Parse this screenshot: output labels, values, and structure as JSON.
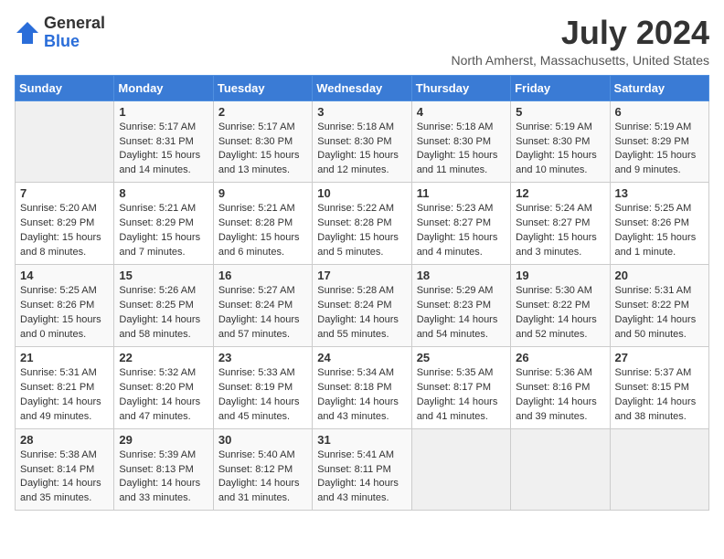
{
  "logo": {
    "general": "General",
    "blue": "Blue"
  },
  "header": {
    "title": "July 2024",
    "location": "North Amherst, Massachusetts, United States"
  },
  "weekdays": [
    "Sunday",
    "Monday",
    "Tuesday",
    "Wednesday",
    "Thursday",
    "Friday",
    "Saturday"
  ],
  "weeks": [
    [
      {
        "day": "",
        "info": ""
      },
      {
        "day": "1",
        "info": "Sunrise: 5:17 AM\nSunset: 8:31 PM\nDaylight: 15 hours\nand 14 minutes."
      },
      {
        "day": "2",
        "info": "Sunrise: 5:17 AM\nSunset: 8:30 PM\nDaylight: 15 hours\nand 13 minutes."
      },
      {
        "day": "3",
        "info": "Sunrise: 5:18 AM\nSunset: 8:30 PM\nDaylight: 15 hours\nand 12 minutes."
      },
      {
        "day": "4",
        "info": "Sunrise: 5:18 AM\nSunset: 8:30 PM\nDaylight: 15 hours\nand 11 minutes."
      },
      {
        "day": "5",
        "info": "Sunrise: 5:19 AM\nSunset: 8:30 PM\nDaylight: 15 hours\nand 10 minutes."
      },
      {
        "day": "6",
        "info": "Sunrise: 5:19 AM\nSunset: 8:29 PM\nDaylight: 15 hours\nand 9 minutes."
      }
    ],
    [
      {
        "day": "7",
        "info": "Sunrise: 5:20 AM\nSunset: 8:29 PM\nDaylight: 15 hours\nand 8 minutes."
      },
      {
        "day": "8",
        "info": "Sunrise: 5:21 AM\nSunset: 8:29 PM\nDaylight: 15 hours\nand 7 minutes."
      },
      {
        "day": "9",
        "info": "Sunrise: 5:21 AM\nSunset: 8:28 PM\nDaylight: 15 hours\nand 6 minutes."
      },
      {
        "day": "10",
        "info": "Sunrise: 5:22 AM\nSunset: 8:28 PM\nDaylight: 15 hours\nand 5 minutes."
      },
      {
        "day": "11",
        "info": "Sunrise: 5:23 AM\nSunset: 8:27 PM\nDaylight: 15 hours\nand 4 minutes."
      },
      {
        "day": "12",
        "info": "Sunrise: 5:24 AM\nSunset: 8:27 PM\nDaylight: 15 hours\nand 3 minutes."
      },
      {
        "day": "13",
        "info": "Sunrise: 5:25 AM\nSunset: 8:26 PM\nDaylight: 15 hours\nand 1 minute."
      }
    ],
    [
      {
        "day": "14",
        "info": "Sunrise: 5:25 AM\nSunset: 8:26 PM\nDaylight: 15 hours\nand 0 minutes."
      },
      {
        "day": "15",
        "info": "Sunrise: 5:26 AM\nSunset: 8:25 PM\nDaylight: 14 hours\nand 58 minutes."
      },
      {
        "day": "16",
        "info": "Sunrise: 5:27 AM\nSunset: 8:24 PM\nDaylight: 14 hours\nand 57 minutes."
      },
      {
        "day": "17",
        "info": "Sunrise: 5:28 AM\nSunset: 8:24 PM\nDaylight: 14 hours\nand 55 minutes."
      },
      {
        "day": "18",
        "info": "Sunrise: 5:29 AM\nSunset: 8:23 PM\nDaylight: 14 hours\nand 54 minutes."
      },
      {
        "day": "19",
        "info": "Sunrise: 5:30 AM\nSunset: 8:22 PM\nDaylight: 14 hours\nand 52 minutes."
      },
      {
        "day": "20",
        "info": "Sunrise: 5:31 AM\nSunset: 8:22 PM\nDaylight: 14 hours\nand 50 minutes."
      }
    ],
    [
      {
        "day": "21",
        "info": "Sunrise: 5:31 AM\nSunset: 8:21 PM\nDaylight: 14 hours\nand 49 minutes."
      },
      {
        "day": "22",
        "info": "Sunrise: 5:32 AM\nSunset: 8:20 PM\nDaylight: 14 hours\nand 47 minutes."
      },
      {
        "day": "23",
        "info": "Sunrise: 5:33 AM\nSunset: 8:19 PM\nDaylight: 14 hours\nand 45 minutes."
      },
      {
        "day": "24",
        "info": "Sunrise: 5:34 AM\nSunset: 8:18 PM\nDaylight: 14 hours\nand 43 minutes."
      },
      {
        "day": "25",
        "info": "Sunrise: 5:35 AM\nSunset: 8:17 PM\nDaylight: 14 hours\nand 41 minutes."
      },
      {
        "day": "26",
        "info": "Sunrise: 5:36 AM\nSunset: 8:16 PM\nDaylight: 14 hours\nand 39 minutes."
      },
      {
        "day": "27",
        "info": "Sunrise: 5:37 AM\nSunset: 8:15 PM\nDaylight: 14 hours\nand 38 minutes."
      }
    ],
    [
      {
        "day": "28",
        "info": "Sunrise: 5:38 AM\nSunset: 8:14 PM\nDaylight: 14 hours\nand 35 minutes."
      },
      {
        "day": "29",
        "info": "Sunrise: 5:39 AM\nSunset: 8:13 PM\nDaylight: 14 hours\nand 33 minutes."
      },
      {
        "day": "30",
        "info": "Sunrise: 5:40 AM\nSunset: 8:12 PM\nDaylight: 14 hours\nand 31 minutes."
      },
      {
        "day": "31",
        "info": "Sunrise: 5:41 AM\nSunset: 8:11 PM\nDaylight: 14 hours\nand 43 minutes."
      },
      {
        "day": "",
        "info": ""
      },
      {
        "day": "",
        "info": ""
      },
      {
        "day": "",
        "info": ""
      }
    ]
  ]
}
